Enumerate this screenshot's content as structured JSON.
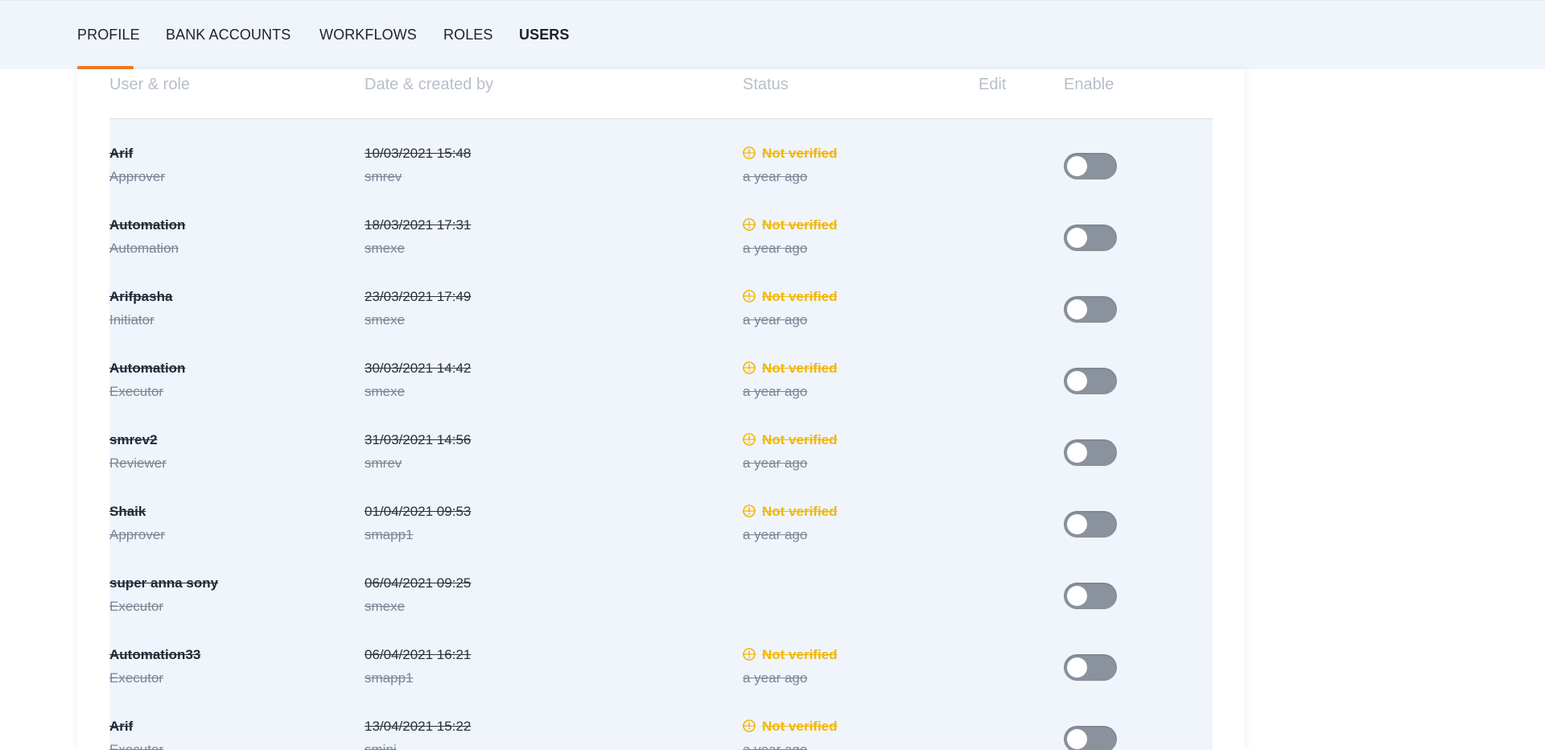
{
  "nav": {
    "tabs": [
      {
        "label": "PROFILE"
      },
      {
        "label": "BANK ACCOUNTS"
      },
      {
        "label": "WORKFLOWS"
      },
      {
        "label": "ROLES"
      },
      {
        "label": "USERS"
      }
    ]
  },
  "table": {
    "headers": {
      "user_role": "User & role",
      "date_created": "Date & created by",
      "status": "Status",
      "edit": "Edit",
      "enable": "Enable"
    },
    "rows": [
      {
        "name": "Arif",
        "role": "Approver",
        "date": "10/03/2021 15:48",
        "created_by": "smrev",
        "status": "Not verified",
        "status_ago": "a year ago",
        "enabled": false
      },
      {
        "name": "Automation",
        "role": "Automation",
        "date": "18/03/2021 17:31",
        "created_by": "smexe",
        "status": "Not verified",
        "status_ago": "a year ago",
        "enabled": false
      },
      {
        "name": "Arifpasha",
        "role": "Initiator",
        "date": "23/03/2021 17:49",
        "created_by": "smexe",
        "status": "Not verified",
        "status_ago": "a year ago",
        "enabled": false
      },
      {
        "name": "Automation",
        "role": "Executor",
        "date": "30/03/2021 14:42",
        "created_by": "smexe",
        "status": "Not verified",
        "status_ago": "a year ago",
        "enabled": false
      },
      {
        "name": "smrev2",
        "role": "Reviewer",
        "date": "31/03/2021 14:56",
        "created_by": "smrev",
        "status": "Not verified",
        "status_ago": "a year ago",
        "enabled": false
      },
      {
        "name": "Shaik",
        "role": "Approver",
        "date": "01/04/2021 09:53",
        "created_by": "smapp1",
        "status": "Not verified",
        "status_ago": "a year ago",
        "enabled": false
      },
      {
        "name": "super anna sony",
        "role": "Executor",
        "date": "06/04/2021 09:25",
        "created_by": "smexe",
        "status": "",
        "status_ago": "",
        "enabled": false
      },
      {
        "name": "Automation33",
        "role": "Executor",
        "date": "06/04/2021 16:21",
        "created_by": "smapp1",
        "status": "Not verified",
        "status_ago": "a year ago",
        "enabled": false
      },
      {
        "name": "Arif",
        "role": "Executor",
        "date": "13/04/2021 15:22",
        "created_by": "smini",
        "status": "Not verified",
        "status_ago": "a year ago",
        "enabled": false
      }
    ]
  },
  "colors": {
    "accent": "#f07d23",
    "warning": "#f2b705",
    "toggle_off": "#8a929d",
    "nav_bg": "#f0f4fb"
  },
  "icons": {
    "status": "alert-circle-icon"
  }
}
